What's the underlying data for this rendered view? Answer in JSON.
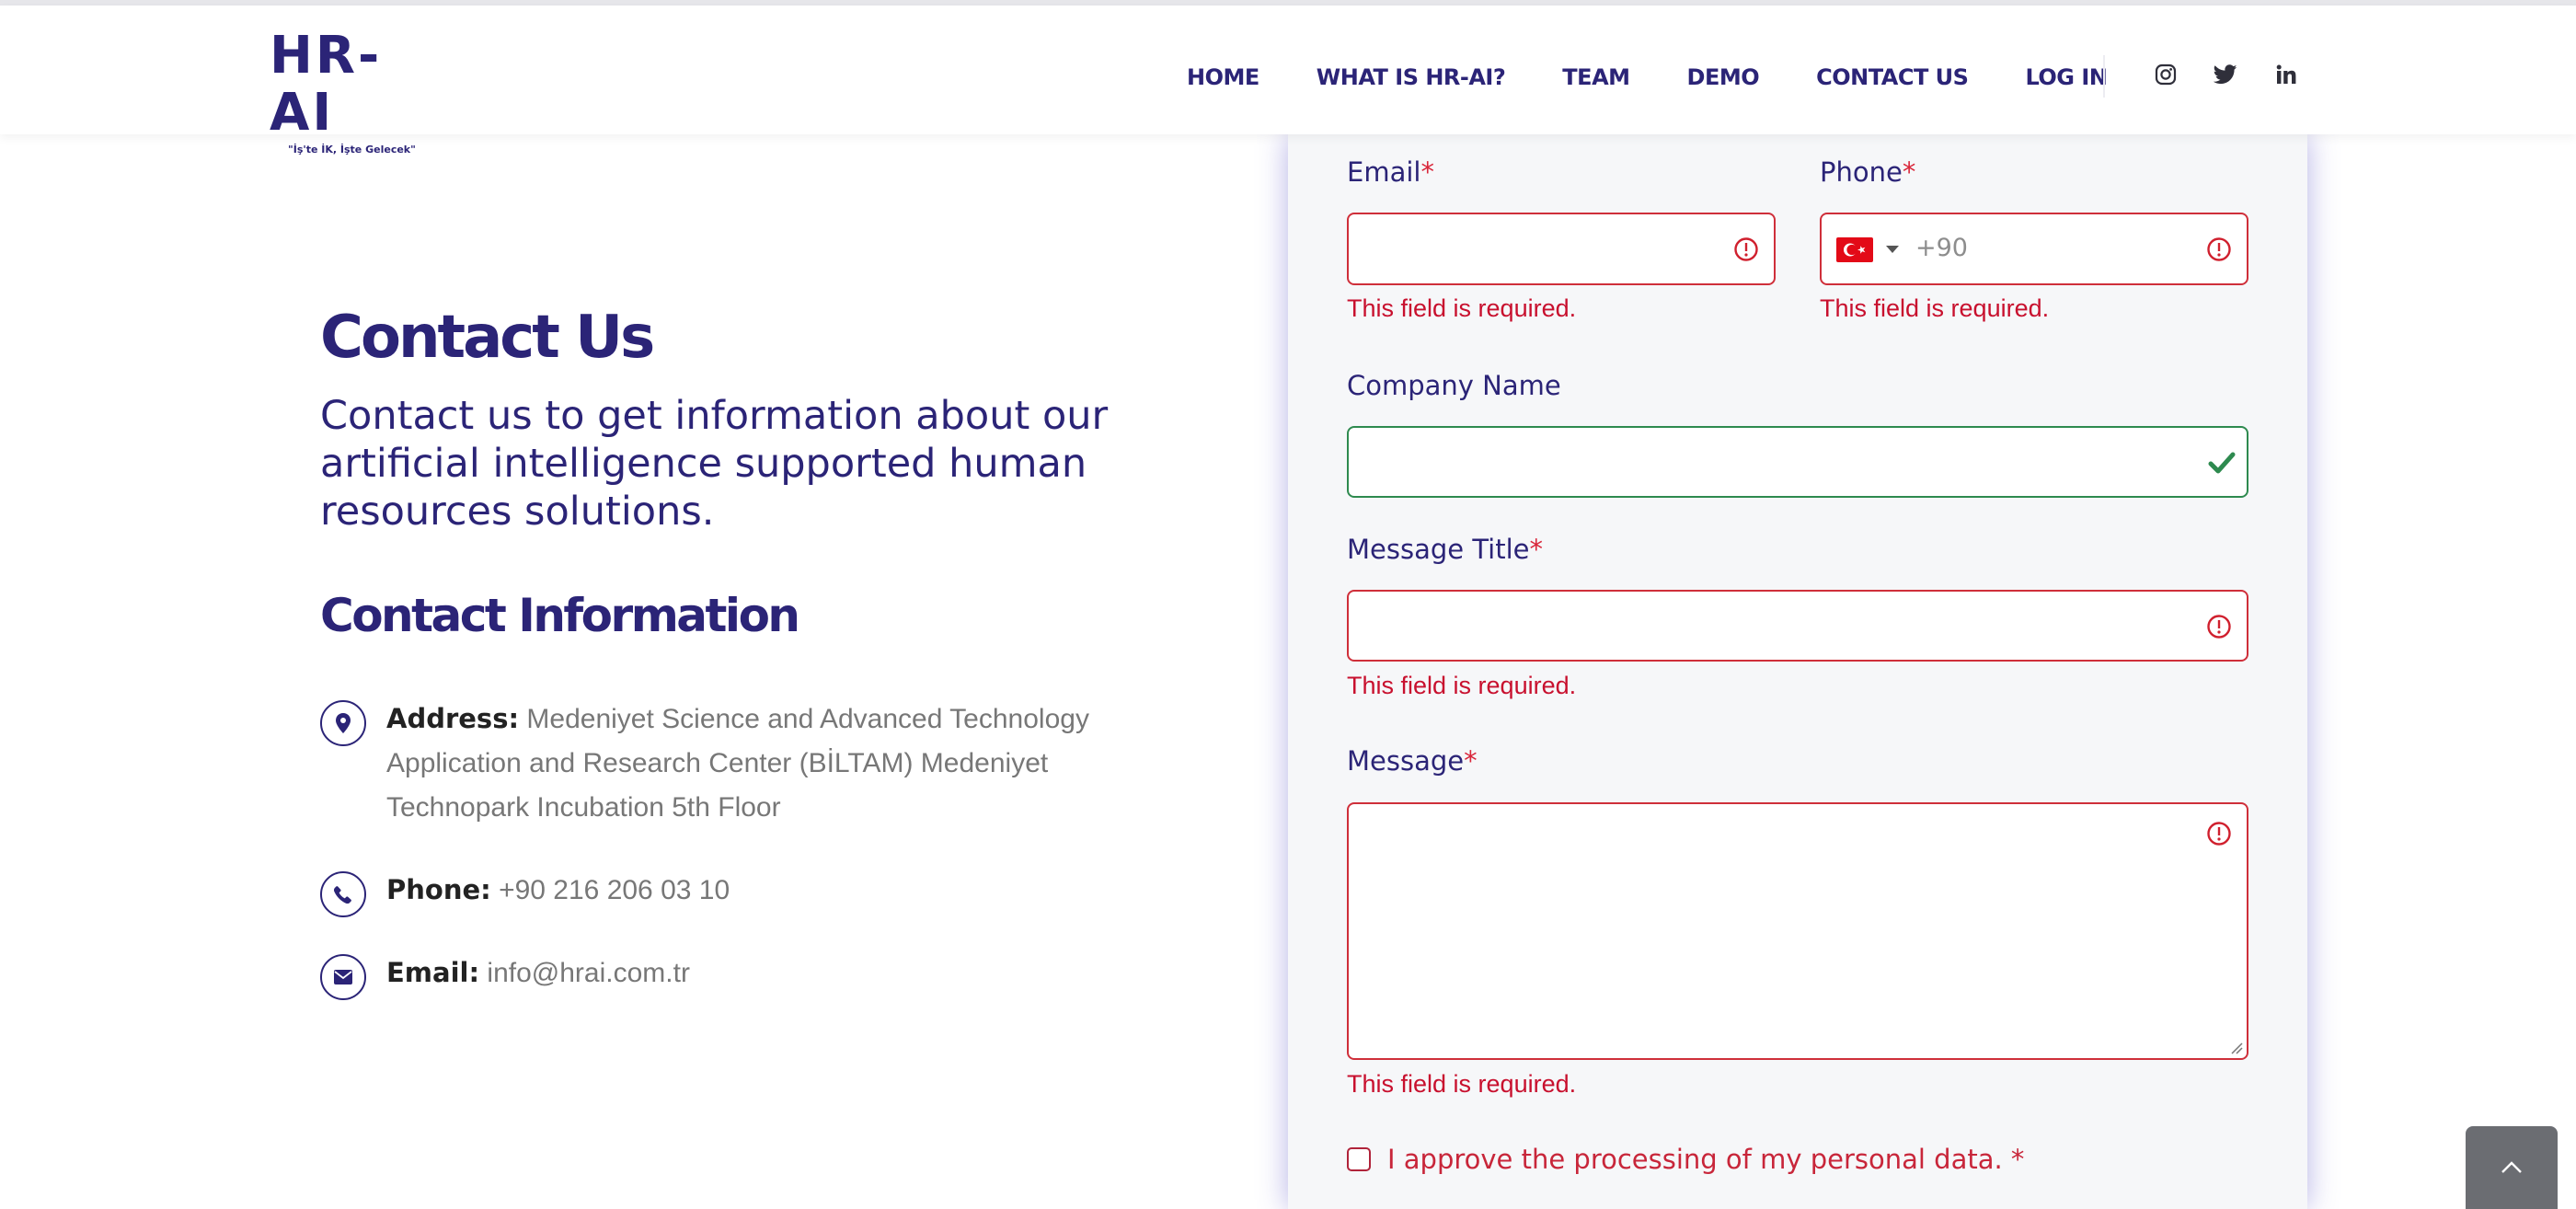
{
  "brand": {
    "name": "HR-AI",
    "tagline": "\"İş'te İK, İşte Gelecek\""
  },
  "nav": {
    "items": [
      "HOME",
      "WHAT IS HR-AI?",
      "TEAM",
      "DEMO",
      "CONTACT US",
      "LOG IN"
    ],
    "social": [
      "instagram-icon",
      "twitter-icon",
      "linkedin-icon"
    ]
  },
  "contact": {
    "title": "Contact Us",
    "lead": "Contact us to get information about our artificial intelligence supported human resources solutions.",
    "info_title": "Contact Information",
    "address_label": "Address:",
    "address_value": "Medeniyet Science and Advanced Technology Application and Research Center (BİLTAM) Medeniyet Technopark Incubation 5th Floor",
    "phone_label": "Phone:",
    "phone_value": "+90 216 206 03 10",
    "email_label": "Email:",
    "email_value": "info@hrai.com.tr"
  },
  "form": {
    "email_label": "Email",
    "phone_label": "Phone",
    "phone_prefix": "+90",
    "company_label": "Company Name",
    "message_title_label": "Message Title",
    "message_label": "Message",
    "required_mark": "*",
    "error_text": "This field is required.",
    "consent_text": "I approve the processing of my personal data. *"
  },
  "colors": {
    "brand": "#2b2477",
    "error": "#c8102e",
    "valid": "#2e8a4f",
    "card_bg": "#f6f7f9"
  }
}
